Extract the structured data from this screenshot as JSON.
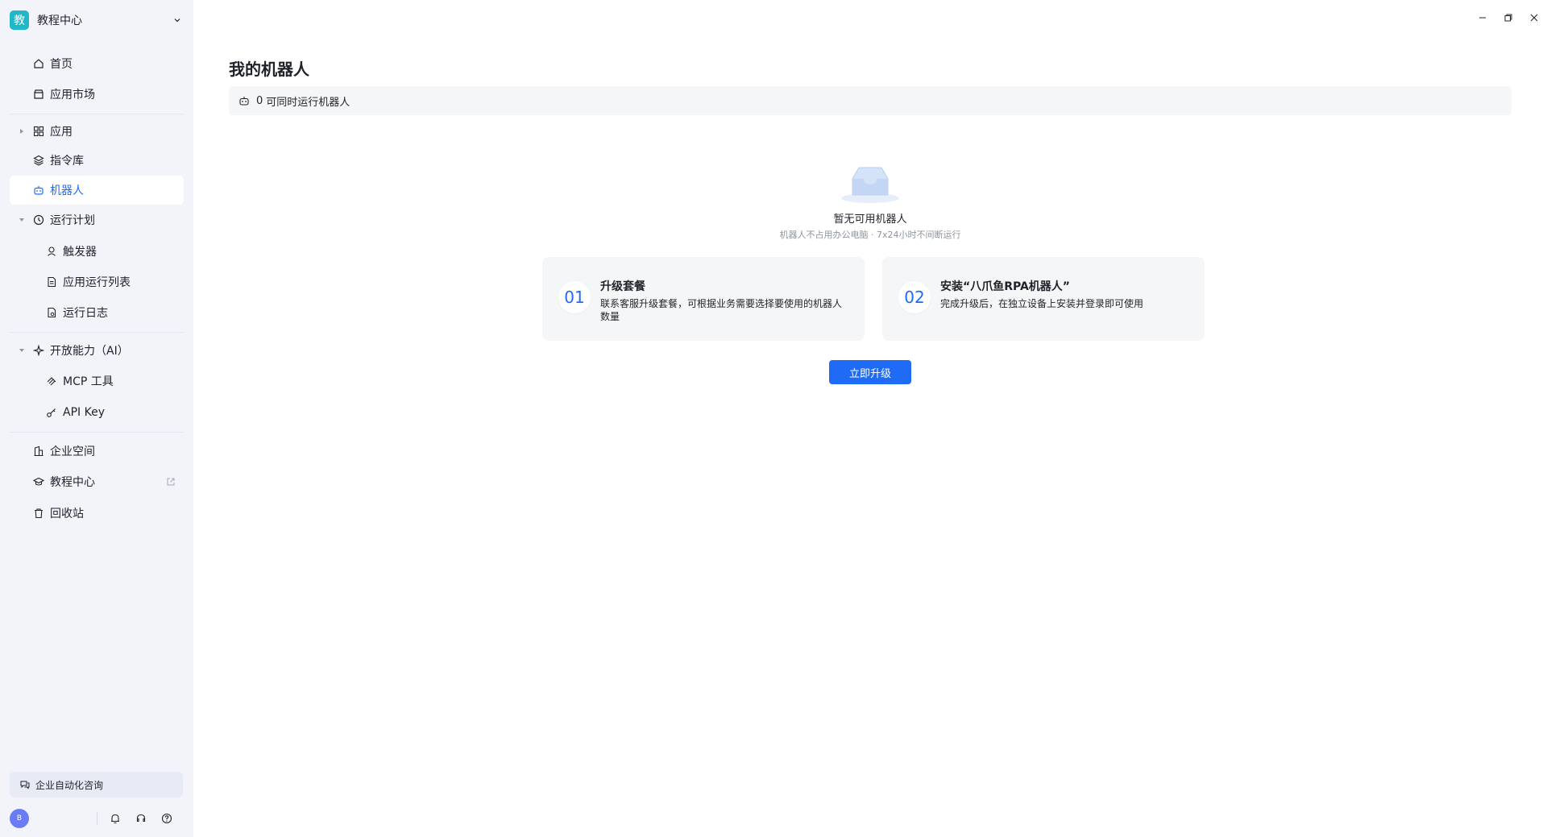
{
  "workspace": {
    "logo_char": "教",
    "name": "教程中心"
  },
  "nav": {
    "home": "首页",
    "market": "应用市场",
    "apps": "应用",
    "commands": "指令库",
    "robots": "机器人",
    "schedule": "运行计划",
    "triggers": "触发器",
    "app_runs": "应用运行列表",
    "run_logs": "运行日志",
    "open_ai": "开放能力（AI）",
    "mcp_tools": "MCP 工具",
    "api_key": "API Key",
    "enterprise": "企业空间",
    "tutorial": "教程中心",
    "recycle": "回收站"
  },
  "consult": {
    "label": "企业自动化咨询"
  },
  "user": {
    "avatar_initial": "B"
  },
  "page": {
    "title": "我的机器人",
    "concurrent_count": "0",
    "concurrent_label": "可同时运行机器人"
  },
  "empty_state": {
    "title": "暂无可用机器人",
    "subtitle": "机器人不占用办公电脑 · 7x24小时不间断运行"
  },
  "steps": [
    {
      "num": "01",
      "title": "升级套餐",
      "desc": "联系客服升级套餐，可根据业务需要选择要使用的机器人数量"
    },
    {
      "num": "02",
      "title": "安装“八爪鱼RPA机器人”",
      "desc": "完成升级后，在独立设备上安装并登录即可使用"
    }
  ],
  "cta": {
    "label": "立即升级"
  },
  "colors": {
    "accent": "#1f6bf5",
    "sidebar_bg": "#f2f4f9",
    "card_bg": "#f5f6f8"
  }
}
